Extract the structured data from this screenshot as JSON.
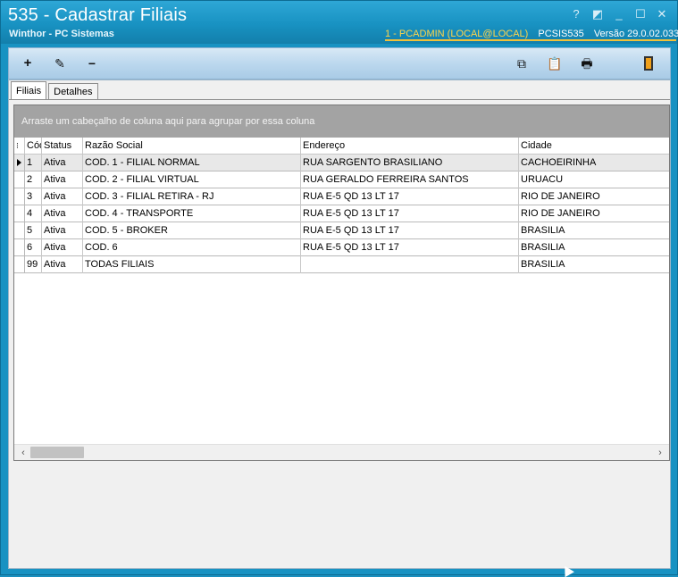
{
  "window": {
    "title": "535 - Cadastrar Filiais",
    "subtitle": "Winthor - PC Sistemas",
    "user": "1 - PCADMIN (LOCAL@LOCAL)",
    "program": "PCSIS535",
    "version": "Versão  29.0.02.033",
    "controls": {
      "help": "?",
      "restore": "◩",
      "minimize": "_",
      "maximize": "☐",
      "close": "✕"
    }
  },
  "toolbar": {
    "add": "+",
    "edit": "✎",
    "remove": "−",
    "copy": "⧉",
    "clipboard": "📋",
    "print": "🖶"
  },
  "tabs": [
    {
      "label": "Filiais",
      "active": true
    },
    {
      "label": "Detalhes",
      "active": false
    }
  ],
  "grid": {
    "group_hint": "Arraste um cabeçalho de coluna aqui para agrupar por essa coluna",
    "indicator_icon": "⁝",
    "columns": [
      "Cód",
      "Status",
      "Razão Social",
      "Endereço",
      "Cidade"
    ],
    "rows": [
      {
        "cod": "1",
        "status": "Ativa",
        "razao": "COD. 1 - FILIAL NORMAL",
        "endereco": "RUA SARGENTO BRASILIANO",
        "cidade": "CACHOEIRINHA"
      },
      {
        "cod": "2",
        "status": "Ativa",
        "razao": "COD. 2 - FILIAL VIRTUAL",
        "endereco": "RUA GERALDO FERREIRA SANTOS",
        "cidade": "URUACU"
      },
      {
        "cod": "3",
        "status": "Ativa",
        "razao": "COD. 3 - FILIAL RETIRA - RJ",
        "endereco": "RUA E-5 QD 13 LT 17",
        "cidade": "RIO DE JANEIRO"
      },
      {
        "cod": "4",
        "status": "Ativa",
        "razao": "COD. 4 - TRANSPORTE",
        "endereco": "RUA E-5 QD 13 LT 17",
        "cidade": "RIO DE JANEIRO"
      },
      {
        "cod": "5",
        "status": "Ativa",
        "razao": "COD. 5 - BROKER",
        "endereco": "RUA E-5 QD 13 LT 17",
        "cidade": "BRASILIA"
      },
      {
        "cod": "6",
        "status": "Ativa",
        "razao": "COD. 6",
        "endereco": "RUA E-5 QD 13 LT 17",
        "cidade": "BRASILIA"
      },
      {
        "cod": "99",
        "status": "Ativa",
        "razao": "TODAS FILIAIS",
        "endereco": "",
        "cidade": "BRASILIA"
      }
    ],
    "scroll": {
      "left": "‹",
      "right": "›"
    }
  },
  "colors": {
    "titlebar": "#1892c2",
    "accent_line": "#f0c03a",
    "group_panel": "#a3a3a3"
  }
}
